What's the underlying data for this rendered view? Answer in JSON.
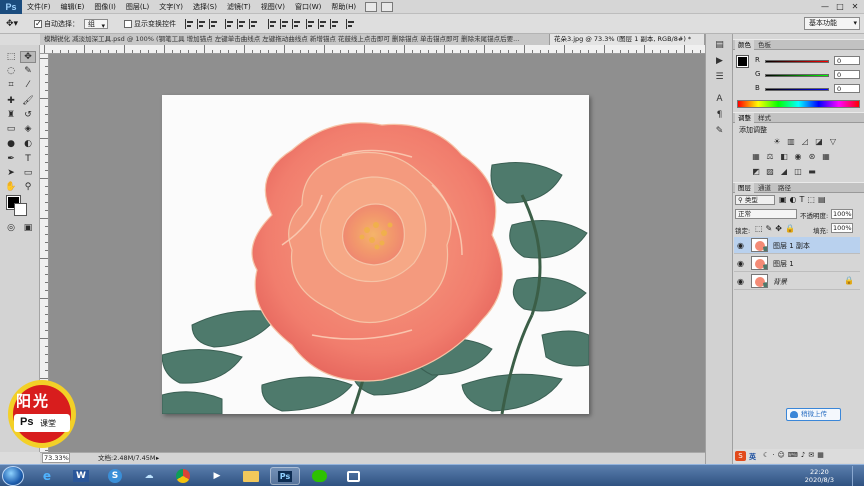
{
  "app": {
    "logo": "Ps",
    "menu": [
      "文件(F)",
      "编辑(E)",
      "图像(I)",
      "图层(L)",
      "文字(Y)",
      "选择(S)",
      "滤镜(T)",
      "视图(V)",
      "窗口(W)",
      "帮助(H)"
    ],
    "window_controls": [
      "—",
      "□",
      "✕"
    ]
  },
  "options_bar": {
    "auto_select_label": "自动选择：",
    "auto_select_value": "组",
    "show_transform_label": "显示变换控件",
    "workspace": "基本功能"
  },
  "tabs": [
    {
      "label": "模糊锐化 减淡加深工具.psd @ 100% (钢笔工具 增加锚点 左键单击曲线点 左键拖动曲线点 新增锚点 花鼓线上点击即可 删除锚点 单击锚点即可 删除未尾锚点后要...",
      "active": false
    },
    {
      "label": "花朵3.jpg @ 73.3% (图层 1 副本, RGB/8#) *",
      "active": true
    }
  ],
  "status": {
    "zoom": "73.33%",
    "doc_info": "文档:2.48M/7.45M"
  },
  "color_panel": {
    "tabs": [
      "颜色",
      "色板"
    ],
    "channels": [
      {
        "label": "R",
        "value": "0",
        "color": "#c00000"
      },
      {
        "label": "G",
        "value": "0",
        "color": "#00a000"
      },
      {
        "label": "B",
        "value": "0",
        "color": "#0000c0"
      }
    ]
  },
  "adjust_panel": {
    "tabs": [
      "调整",
      "样式"
    ],
    "title": "添加调整"
  },
  "layers_panel": {
    "tabs": [
      "图层",
      "通道",
      "路径"
    ],
    "filter_kind": "类型",
    "blend_mode": "正常",
    "opacity_label": "不透明度:",
    "opacity_value": "100%",
    "lock_label": "锁定:",
    "fill_label": "填充:",
    "fill_value": "100%",
    "layers": [
      {
        "name": "图层 1 副本",
        "selected": true,
        "italic": false,
        "locked": false
      },
      {
        "name": "图层 1",
        "selected": false,
        "italic": false,
        "locked": false
      },
      {
        "name": "背景",
        "selected": false,
        "italic": true,
        "locked": true
      }
    ]
  },
  "upload_button": "稍微上传",
  "ime": {
    "label": "英"
  },
  "taskbar": {
    "clock_time": "22:20",
    "clock_date": "2020/8/3"
  },
  "logo": {
    "top_text": "阳光",
    "bottom_text": "Ps",
    "course_text": "课堂"
  }
}
